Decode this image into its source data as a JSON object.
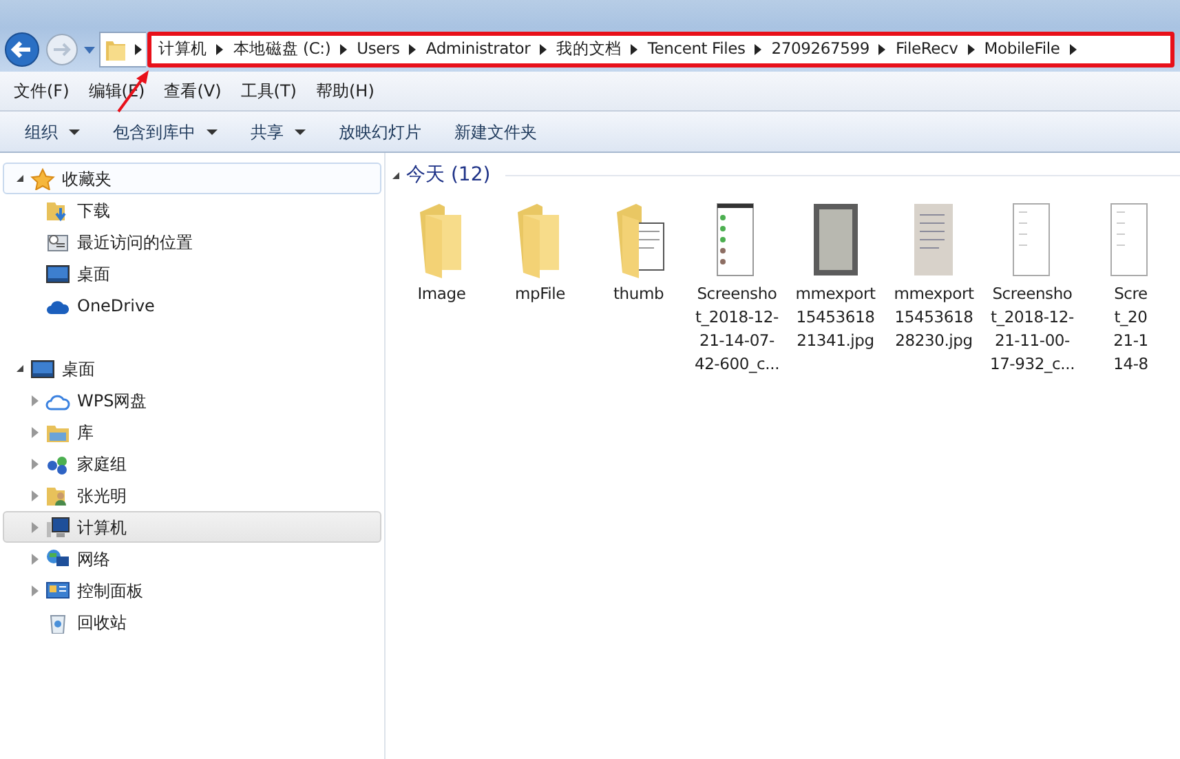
{
  "address_bar": {
    "breadcrumb": [
      "计算机",
      "本地磁盘 (C:)",
      "Users",
      "Administrator",
      "我的文档",
      "Tencent Files",
      "2709267599",
      "FileRecv",
      "MobileFile"
    ],
    "highlighted": true
  },
  "menu_bar": [
    "文件(F)",
    "编辑(E)",
    "查看(V)",
    "工具(T)",
    "帮助(H)"
  ],
  "toolbar": [
    {
      "label": "组织",
      "dropdown": true
    },
    {
      "label": "包含到库中",
      "dropdown": true
    },
    {
      "label": "共享",
      "dropdown": true
    },
    {
      "label": "放映幻灯片",
      "dropdown": false
    },
    {
      "label": "新建文件夹",
      "dropdown": false
    }
  ],
  "navigation": [
    {
      "label": "收藏夹",
      "kind": "star",
      "expanded": true,
      "selected": false,
      "focused": true,
      "children": [
        {
          "label": "下载",
          "kind": "download",
          "selected": false,
          "focused": false
        },
        {
          "label": "最近访问的位置",
          "kind": "recent",
          "selected": false,
          "focused": false
        },
        {
          "label": "桌面",
          "kind": "desktop",
          "selected": false,
          "focused": false
        },
        {
          "label": "OneDrive",
          "kind": "cloud",
          "selected": false,
          "focused": false
        }
      ]
    },
    {
      "label": "桌面",
      "kind": "desktop",
      "expanded": true,
      "selected": false,
      "focused": false,
      "children": [
        {
          "label": "WPS网盘",
          "kind": "cloud-outline",
          "expanded": false,
          "selected": false,
          "focused": false
        },
        {
          "label": "库",
          "kind": "library",
          "expanded": false,
          "selected": false,
          "focused": false
        },
        {
          "label": "家庭组",
          "kind": "homegroup",
          "expanded": false,
          "selected": false,
          "focused": false
        },
        {
          "label": "张光明",
          "kind": "user",
          "expanded": false,
          "selected": false,
          "focused": false
        },
        {
          "label": "计算机",
          "kind": "computer",
          "expanded": false,
          "selected": true,
          "focused": false
        },
        {
          "label": "网络",
          "kind": "network",
          "expanded": false,
          "selected": false,
          "focused": false
        },
        {
          "label": "控制面板",
          "kind": "control-panel",
          "expanded": false,
          "selected": false,
          "focused": false
        },
        {
          "label": "回收站",
          "kind": "recycle-bin",
          "selected": false,
          "focused": false
        }
      ]
    }
  ],
  "group": {
    "title": "今天 (12)",
    "expanded": true
  },
  "files": [
    {
      "kind": "folder",
      "lines": [
        "Image"
      ]
    },
    {
      "kind": "folder",
      "lines": [
        "mpFile"
      ]
    },
    {
      "kind": "folder-preview",
      "lines": [
        "thumb"
      ]
    },
    {
      "kind": "screenshot",
      "lines": [
        "Screensho",
        "t_2018-12-",
        "21-14-07-",
        "42-600_c..."
      ]
    },
    {
      "kind": "photo",
      "lines": [
        "mmexport",
        "15453618",
        "21341.jpg"
      ]
    },
    {
      "kind": "document-photo",
      "lines": [
        "mmexport",
        "15453618",
        "28230.jpg"
      ]
    },
    {
      "kind": "blank-screenshot",
      "lines": [
        "Screensho",
        "t_2018-12-",
        "21-11-00-",
        "17-932_c..."
      ]
    },
    {
      "kind": "blank-screenshot",
      "lines": [
        "Scre",
        "t_20",
        "21-1",
        "14-8"
      ]
    }
  ]
}
